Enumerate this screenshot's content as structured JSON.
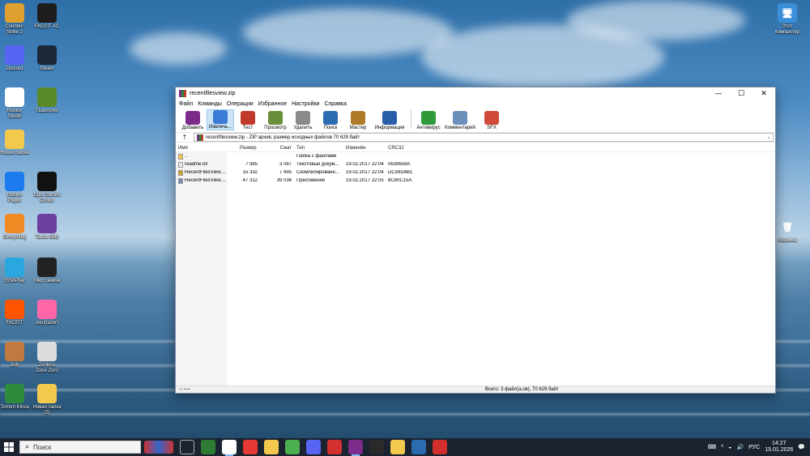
{
  "desktop": {
    "icons": [
      {
        "label": "Counter-Strike 2",
        "color": "#e0a030"
      },
      {
        "label": "FACEIT AC",
        "color": "#1e1e1e"
      },
      {
        "label": "Discord",
        "color": "#5865f2"
      },
      {
        "label": "Steam",
        "color": "#1b2838"
      },
      {
        "label": "Roblox Studio",
        "color": "#ffffff"
      },
      {
        "label": "TLauncher",
        "color": "#5a8a2a"
      },
      {
        "label": "Новая папка",
        "color": "#f2c94c"
      },
      {
        "label": "Roblox Player",
        "color": "#1d7bf0"
      },
      {
        "label": "Epic Games Center",
        "color": "#111111"
      },
      {
        "label": "Everything",
        "color": "#f08a24"
      },
      {
        "label": "Tanks Blitz",
        "color": "#6b3fa0"
      },
      {
        "label": "ISSAPlay",
        "color": "#2ba7e0"
      },
      {
        "label": "Мир танков",
        "color": "#222222"
      },
      {
        "label": "FACEIT",
        "color": "#ff5500"
      },
      {
        "label": "osu!(lazer)",
        "color": "#ff66aa"
      },
      {
        "label": "Jolly",
        "color": "#c07a40"
      },
      {
        "label": "Zenless Zone Zero",
        "color": "#dddddd"
      },
      {
        "label": "Torrent Kinza",
        "color": "#2e8b3d"
      },
      {
        "label": "Новая папка (2)",
        "color": "#f2c94c"
      }
    ],
    "this_pc_label": "Этот компьютер",
    "recycle_label": "Корзина"
  },
  "window": {
    "title": "recentfilesview.zip",
    "controls": {
      "minimize": "—",
      "maximize": "☐",
      "close": "✕"
    },
    "menu": [
      "Файл",
      "Команды",
      "Операции",
      "Избранное",
      "Настройки",
      "Справка"
    ],
    "toolbar": [
      {
        "label": "Добавить",
        "color": "#7d2b8b"
      },
      {
        "label": "Извлечь...",
        "color": "#3a7bd5"
      },
      {
        "label": "Тест",
        "color": "#c0392b"
      },
      {
        "label": "Просмотр",
        "color": "#6a8e3a"
      },
      {
        "label": "Удалить",
        "color": "#8a8a8a"
      },
      {
        "label": "Поиск",
        "color": "#2b6cb0"
      },
      {
        "label": "Мастер",
        "color": "#b07a2a"
      },
      {
        "label": "Информация",
        "color": "#2b5ea8"
      },
      {
        "label": "Антивирус",
        "color": "#2e9a3a"
      },
      {
        "label": "Комментарий",
        "color": "#6b8fb8"
      },
      {
        "label": "SFX",
        "color": "#d04a3a"
      }
    ],
    "address": "recentfilesview.zip - ZIP архив, размер исходных файлов 70 629 байт",
    "columns": [
      "Имя",
      "Размер",
      "Сжат",
      "Тип",
      "Изменён",
      "CRC32"
    ],
    "rows": [
      {
        "name": "..",
        "size": "",
        "packed": "",
        "type": "Папка с файлами",
        "modified": "",
        "crc": ""
      },
      {
        "name": "readme.txt",
        "size": "7 985",
        "packed": "3 087",
        "type": "Текстовый докум...",
        "modified": "19.02.2017 22:04",
        "crc": "0639659A"
      },
      {
        "name": "RecentFilesView....",
        "size": "15 332",
        "packed": "7 495",
        "type": "Скомпилированн...",
        "modified": "19.02.2017 22:04",
        "crc": "DC59D4B1"
      },
      {
        "name": "RecentFilesView....",
        "size": "47 312",
        "packed": "39 036",
        "type": "Приложение",
        "modified": "19.02.2017 22:05",
        "crc": "8C80C15A"
      }
    ],
    "status": "Всего: 3 файл(а,ов), 70 629 байт"
  },
  "taskbar": {
    "search_placeholder": "Поиск",
    "lang": "РУС",
    "time": "14:27",
    "date": "15.01.2026"
  }
}
